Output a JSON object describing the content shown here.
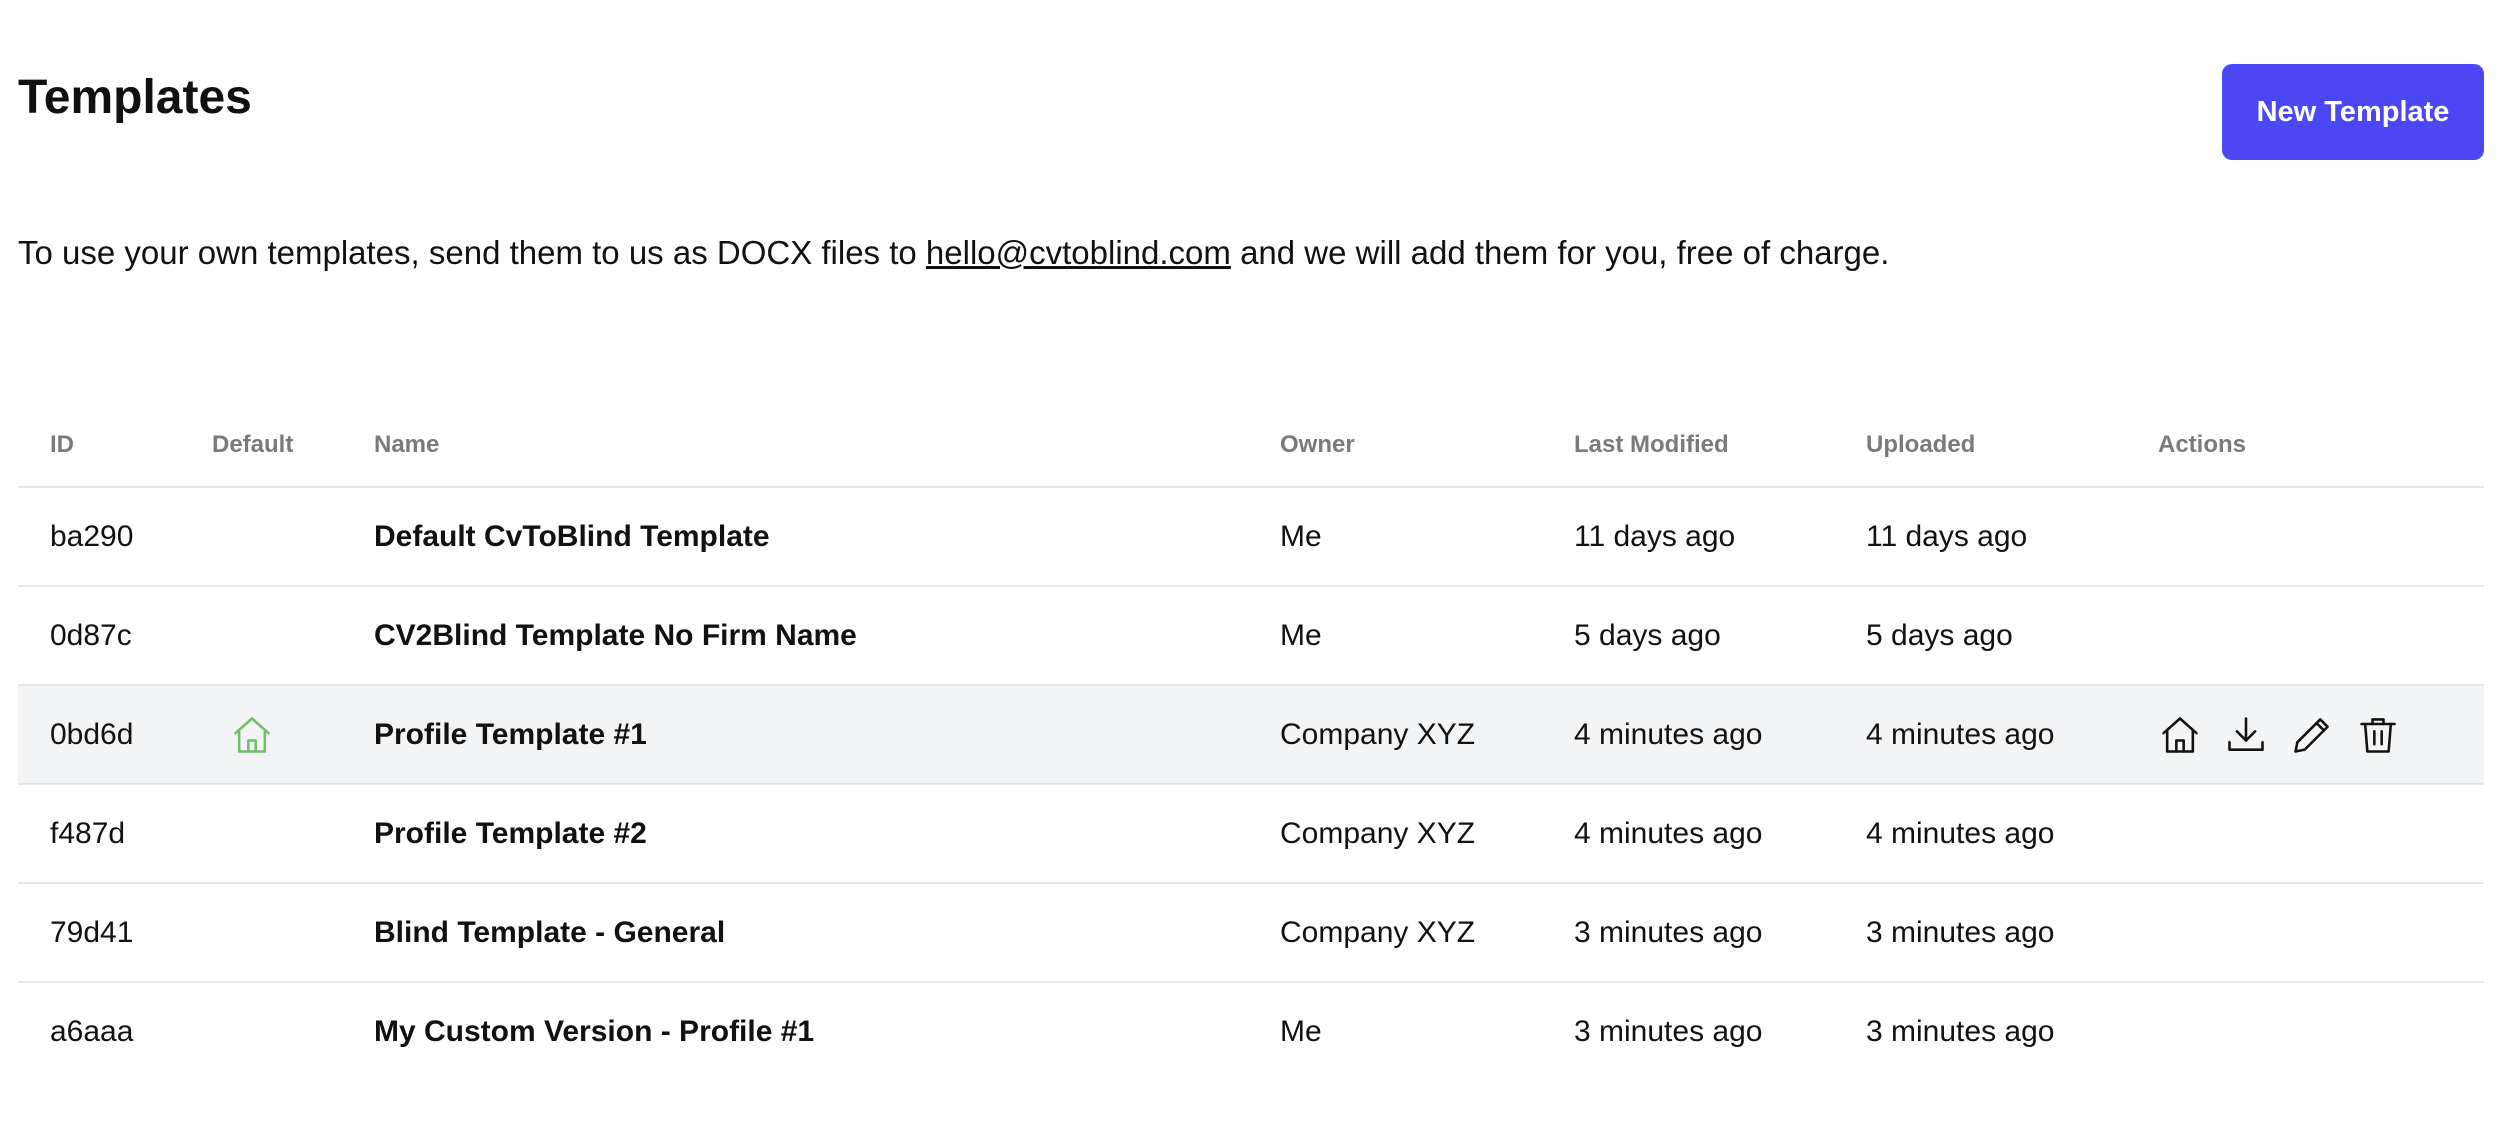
{
  "header": {
    "title": "Templates",
    "new_button_label": "New Template"
  },
  "intro": {
    "text_before": "To use your own templates, send them to us as DOCX files to ",
    "email": "hello@cvtoblind.com",
    "text_after": " and we will add them for you, free of charge."
  },
  "table": {
    "columns": {
      "id": "ID",
      "default": "Default",
      "name": "Name",
      "owner": "Owner",
      "last_modified": "Last Modified",
      "uploaded": "Uploaded",
      "actions": "Actions"
    },
    "rows": [
      {
        "id": "ba290",
        "name": "Default CvToBlind Template",
        "owner": "Me",
        "last_modified": "11 days ago",
        "uploaded": "11 days ago"
      },
      {
        "id": "0d87c",
        "name": "CV2Blind Template No Firm Name",
        "owner": "Me",
        "last_modified": "5 days ago",
        "uploaded": "5 days ago"
      },
      {
        "id": "0bd6d",
        "name": "Profile Template #1",
        "owner": "Company XYZ",
        "last_modified": "4 minutes ago",
        "uploaded": "4 minutes ago"
      },
      {
        "id": "f487d",
        "name": "Profile Template #2",
        "owner": "Company XYZ",
        "last_modified": "4 minutes ago",
        "uploaded": "4 minutes ago"
      },
      {
        "id": "79d41",
        "name": "Blind Template - General",
        "owner": "Company XYZ",
        "last_modified": "3 minutes ago",
        "uploaded": "3 minutes ago"
      },
      {
        "id": "a6aaa",
        "name": "My Custom Version - Profile #1",
        "owner": "Me",
        "last_modified": "3 minutes ago",
        "uploaded": "3 minutes ago"
      }
    ]
  },
  "default_row": "0bd6d",
  "hovered_row": "0bd6d",
  "icons": {
    "default_marker": "home-icon",
    "actions": [
      "home-icon",
      "download-icon",
      "pencil-icon",
      "trash-icon"
    ]
  },
  "colors": {
    "accent": "#4c47f5",
    "default_icon": "#6dbf6a",
    "header_text": "#7a7a7a",
    "row_highlight": "#f3f4f6",
    "divider": "#e6e6e6"
  }
}
